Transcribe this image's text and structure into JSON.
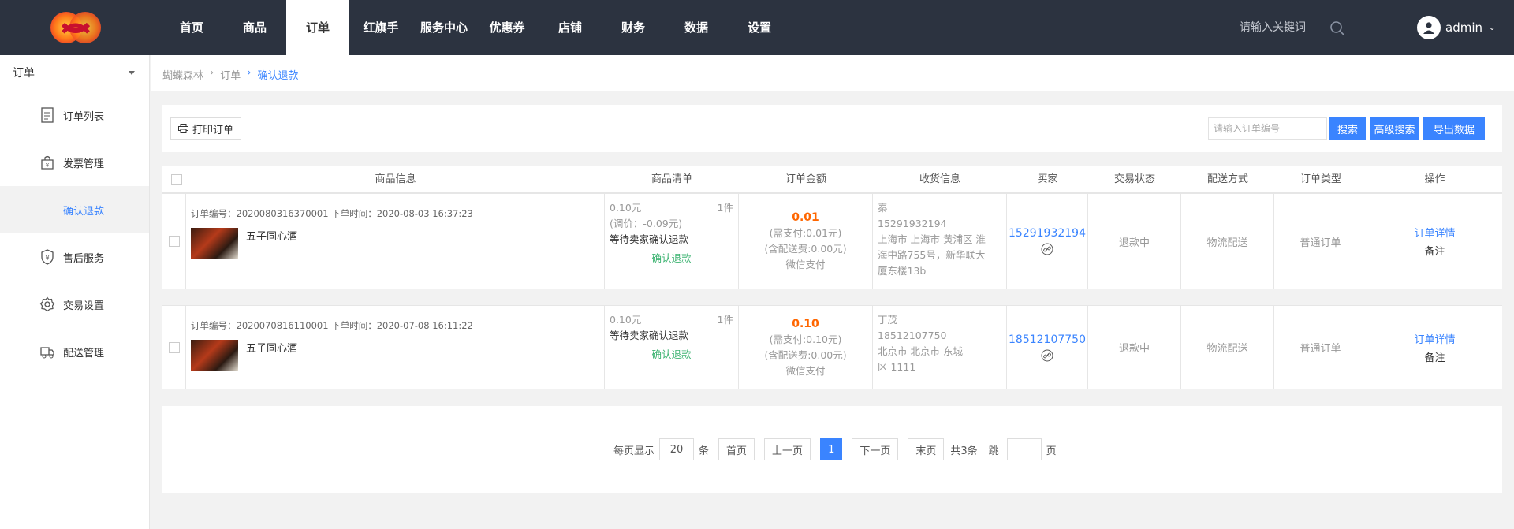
{
  "topbar": {
    "nav": [
      "首页",
      "商品",
      "订单",
      "红旗手",
      "服务中心",
      "优惠券",
      "店铺",
      "财务",
      "数据",
      "设置"
    ],
    "active_nav": "订单",
    "search_placeholder": "请输入关键词",
    "username": "admin"
  },
  "sidebar": {
    "section": "订单",
    "items": [
      {
        "label": "订单列表",
        "icon": "document-icon"
      },
      {
        "label": "发票管理",
        "icon": "bag-icon"
      },
      {
        "label": "确认退款",
        "icon": ""
      },
      {
        "label": "售后服务",
        "icon": "shield-icon"
      },
      {
        "label": "交易设置",
        "icon": "gear-icon"
      },
      {
        "label": "配送管理",
        "icon": "delivery-icon"
      }
    ],
    "active": "确认退款"
  },
  "breadcrumb": [
    "蝴蝶森林",
    "订单",
    "确认退款"
  ],
  "toolbar": {
    "print_label": "打印订单",
    "order_placeholder": "请输入订单编号",
    "search_label": "搜索",
    "advanced_label": "高级搜索",
    "export_label": "导出数据"
  },
  "table": {
    "headers": [
      "商品信息",
      "商品清单",
      "订单金额",
      "收货信息",
      "买家",
      "交易状态",
      "配送方式",
      "订单类型",
      "操作"
    ],
    "rows": [
      {
        "meta": "订单编号：2020080316370001 下单时间：2020-08-03 16:37:23",
        "product": "五子同心酒",
        "price": "0.10元",
        "qty": "1件",
        "adjust": "(调价：-0.09元)",
        "refund_status": "等待卖家确认退款",
        "refund_action": "确认退款",
        "amount": "0.01",
        "need_pay": "(需支付:0.01元)",
        "shipping_fee": "(含配送费:0.00元)",
        "pay_method": "微信支付",
        "receiver_name": "秦",
        "receiver_phone": "15291932194",
        "address": [
          "上海市 上海市 黄浦区 淮",
          "海中路755号，新华联大",
          "厦东楼13b"
        ],
        "buyer": "15291932194",
        "status": "退款中",
        "delivery": "物流配送",
        "type": "普通订单",
        "detail_link": "订单详情",
        "note_link": "备注"
      },
      {
        "meta": "订单编号：2020070816110001 下单时间：2020-07-08 16:11:22",
        "product": "五子同心酒",
        "price": "0.10元",
        "qty": "1件",
        "adjust": "",
        "refund_status": "等待卖家确认退款",
        "refund_action": "确认退款",
        "amount": "0.10",
        "need_pay": "(需支付:0.10元)",
        "shipping_fee": "(含配送费:0.00元)",
        "pay_method": "微信支付",
        "receiver_name": "丁茂",
        "receiver_phone": "18512107750",
        "address": [
          "北京市 北京市 东城",
          "区 1111"
        ],
        "buyer": "18512107750",
        "status": "退款中",
        "delivery": "物流配送",
        "type": "普通订单",
        "detail_link": "订单详情",
        "note_link": "备注"
      }
    ]
  },
  "pagination": {
    "per_page_label": "每页显示",
    "per_page": "20",
    "unit": "条",
    "first": "首页",
    "prev": "上一页",
    "current": "1",
    "next": "下一页",
    "last": "末页",
    "total": "共3条",
    "jump": "跳",
    "page_unit": "页"
  },
  "colors": {
    "topbar": "#2c3340",
    "accent": "#3a84ff",
    "amount": "#ff6600",
    "refund": "#3cb371"
  }
}
